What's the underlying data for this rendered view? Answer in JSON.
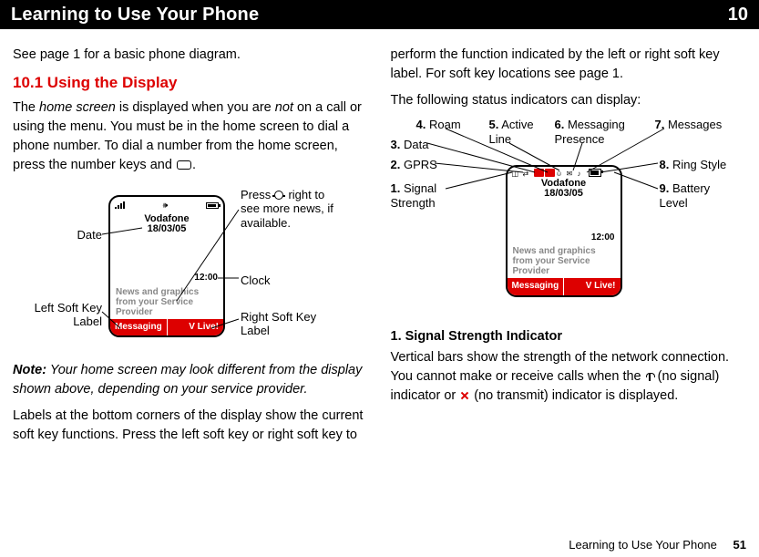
{
  "header": {
    "title": "Learning to Use Your Phone",
    "chapter": "10"
  },
  "left": {
    "p1": "See page 1 for a basic phone diagram.",
    "sec_title": "10.1 Using the Display",
    "p2a": "The ",
    "p2b": "home screen",
    "p2c": " is displayed when you are ",
    "p2d": "not",
    "p2e": " on a call or using the menu. You must be in the home screen to dial a phone number. To dial a number from the home screen, press the number keys and ",
    "p2f": ".",
    "note_a": "Note:",
    "note_b": " Your home screen may look different from the display shown above, depending on your service provider.",
    "p3": "Labels at the bottom corners of the display show the current soft key functions. Press the left soft key or right soft key to",
    "callouts": {
      "date": "Date",
      "left_sk": "Left Soft Key\nLabel",
      "press_right": "Press        right to see more news, if available.",
      "clock": "Clock",
      "right_sk": "Right Soft Key\nLabel"
    },
    "phone": {
      "brand": "Vodafone\n18/03/05",
      "clock": "12:00",
      "news": "News and graphics from your Service Provider",
      "sk_left": "Messaging",
      "sk_right": "V Live!"
    }
  },
  "right": {
    "p1": "perform the function indicated by the left or right soft key label. For soft key locations see page 1.",
    "p2": "The following status indicators can display:",
    "labels": {
      "l1": "Signal Strength",
      "l2": "GPRS",
      "l3": "Data",
      "l4": "Roam",
      "l5": "Active Line",
      "l6": "Messaging Presence",
      "l7": "Messages",
      "l8": "Ring Style",
      "l9": "Battery Level",
      "n1": "1.",
      "n2": "2.",
      "n3": "3.",
      "n4": "4.",
      "n5": "5.",
      "n6": "6.",
      "n7": "7.",
      "n8": "8.",
      "n9": "9."
    },
    "phone": {
      "brand": "Vodafone\n18/03/05",
      "clock": "12:00",
      "news": "News and graphics from your Service Provider",
      "sk_left": "Messaging",
      "sk_right": "V Live!"
    },
    "sub": "1. Signal Strength Indicator",
    "p3a": "Vertical bars show the strength of the network connection. You cannot make or receive calls when the ",
    "p3b": " (no signal) indicator or ",
    "p3c": " (no transmit) indicator is displayed."
  },
  "footer": {
    "text": "Learning to Use Your Phone",
    "page": "51"
  }
}
